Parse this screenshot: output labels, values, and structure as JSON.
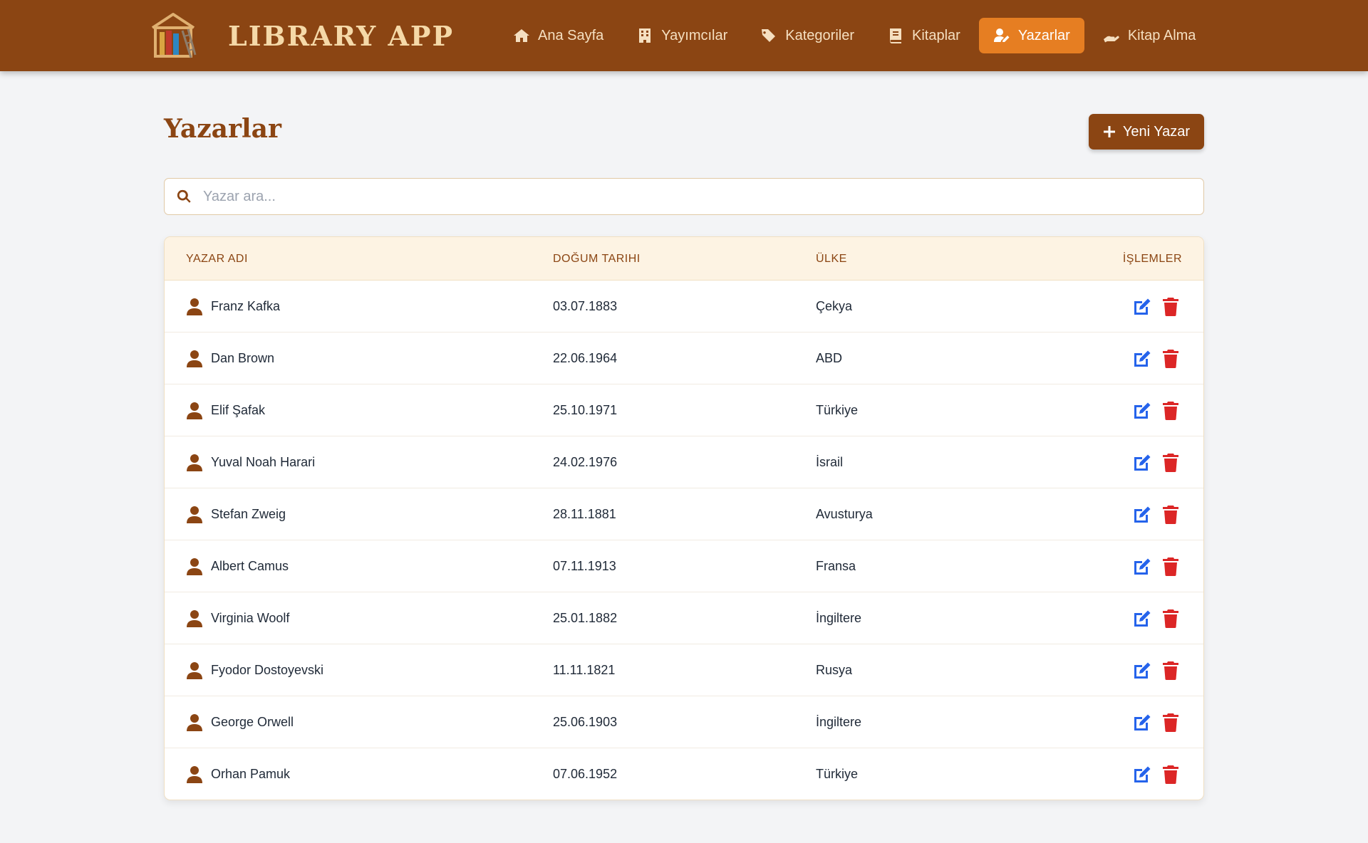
{
  "brand": {
    "title": "LIBRARY APP",
    "logo": "library-shelf-logo"
  },
  "nav": [
    {
      "label": "Ana Sayfa",
      "icon": "home-icon",
      "active": false
    },
    {
      "label": "Yayımcılar",
      "icon": "building-icon",
      "active": false
    },
    {
      "label": "Kategoriler",
      "icon": "tags-icon",
      "active": false
    },
    {
      "label": "Kitaplar",
      "icon": "book-icon",
      "active": false
    },
    {
      "label": "Yazarlar",
      "icon": "user-pen-icon",
      "active": true
    },
    {
      "label": "Kitap Alma",
      "icon": "hand-holding-icon",
      "active": false
    }
  ],
  "page": {
    "title": "Yazarlar",
    "new_button": "Yeni Yazar",
    "search_placeholder": "Yazar ara..."
  },
  "table": {
    "headers": [
      "YAZAR ADI",
      "DOĞUM TARIHI",
      "ÜLKE",
      "İŞLEMLER"
    ],
    "rows": [
      {
        "name": "Franz Kafka",
        "birth": "03.07.1883",
        "country": "Çekya"
      },
      {
        "name": "Dan Brown",
        "birth": "22.06.1964",
        "country": "ABD"
      },
      {
        "name": "Elif Şafak",
        "birth": "25.10.1971",
        "country": "Türkiye"
      },
      {
        "name": "Yuval Noah Harari",
        "birth": "24.02.1976",
        "country": "İsrail"
      },
      {
        "name": "Stefan Zweig",
        "birth": "28.11.1881",
        "country": "Avusturya"
      },
      {
        "name": "Albert Camus",
        "birth": "07.11.1913",
        "country": "Fransa"
      },
      {
        "name": "Virginia Woolf",
        "birth": "25.01.1882",
        "country": "İngiltere"
      },
      {
        "name": "Fyodor Dostoyevski",
        "birth": "11.11.1821",
        "country": "Rusya"
      },
      {
        "name": "George Orwell",
        "birth": "25.06.1903",
        "country": "İngiltere"
      },
      {
        "name": "Orhan Pamuk",
        "birth": "07.06.1952",
        "country": "Türkiye"
      }
    ]
  },
  "colors": {
    "navbar": "#8b4513",
    "active_nav": "#e67e22",
    "edit_icon": "#2563eb",
    "delete_icon": "#dc2626"
  }
}
